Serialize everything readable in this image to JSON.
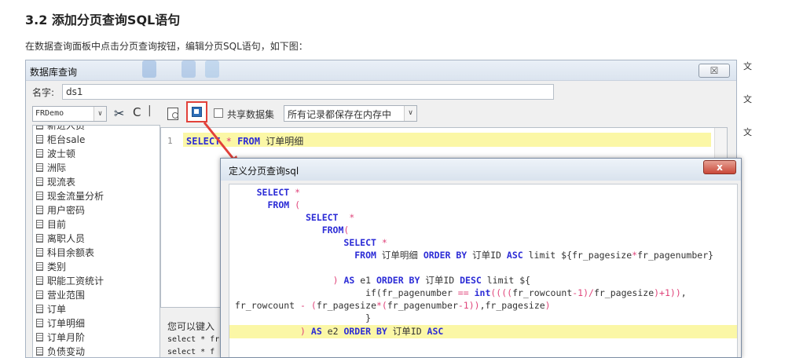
{
  "doc": {
    "heading": "3.2 添加分页查询SQL语句",
    "intro": "在数据查询面板中点击分页查询按钮，编辑分页SQL语句，如下图："
  },
  "dialog": {
    "title": "数据库查询",
    "close_label": "☒",
    "name_label": "名字:",
    "name_value": "ds1",
    "datasource": "FRDemo",
    "share_label": "共享数据集",
    "mode_value": "所有记录都保存在内存中",
    "tables": [
      "新进人员",
      "柜台sale",
      "波士顿",
      "洲际",
      "现流表",
      "现金流量分析",
      "用户密码",
      "目前",
      "离职人员",
      "科目余额表",
      "类别",
      "职能工资统计",
      "营业范围",
      "订单",
      "订单明细",
      "订单月阶",
      "负债变动"
    ],
    "editor_line_no": "1",
    "editor_sql": "SELECT * FROM 订单明细",
    "hint": "您可以键入",
    "hint_code1": "select * fr",
    "hint_code2": "select * f"
  },
  "popup": {
    "title": "定义分页查询sql",
    "close_label": "x"
  },
  "colors": {
    "highlight": "#fbf7a6",
    "keyword": "#2b2bd6",
    "operator": "#e0457b",
    "callout": "#e2413a"
  },
  "icons": [
    "dropdown-arrow-icon",
    "scissors-icon",
    "refresh-icon",
    "preview-icon",
    "paging-query-icon",
    "checkbox-icon",
    "table-icon"
  ]
}
